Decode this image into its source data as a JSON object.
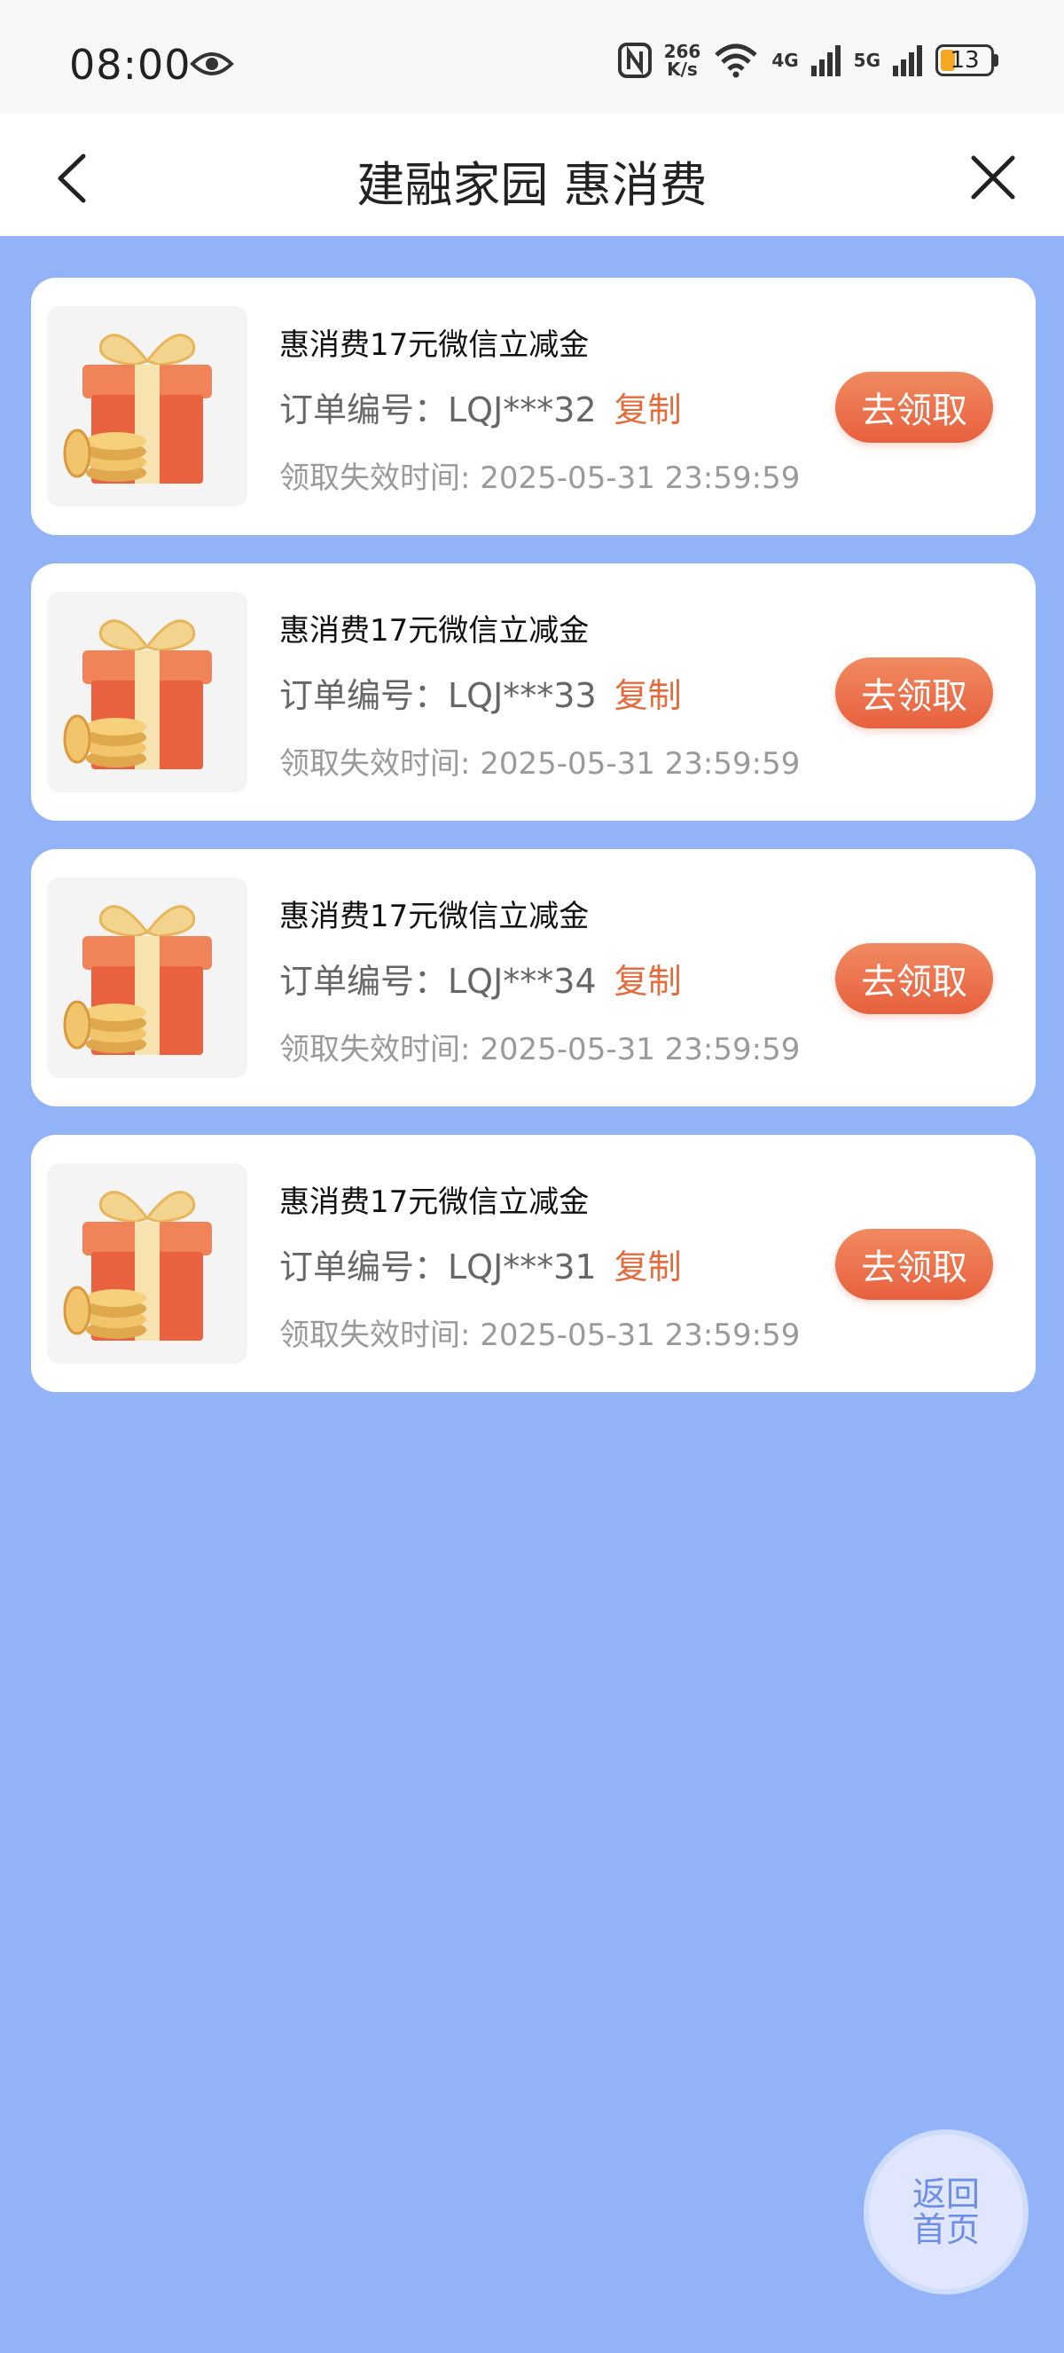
{
  "status_bar": {
    "time": "08:00",
    "speed_value": "266",
    "speed_unit": "K/s",
    "net_4g": "4G",
    "net_5g": "5G",
    "battery": "13",
    "battery_color": "#f5a623"
  },
  "nav": {
    "title": "建融家园 惠消费",
    "back_icon": "chevron-left-icon",
    "close_icon": "close-icon"
  },
  "coupons": [
    {
      "title": "惠消费17元微信立减金",
      "order_label": "订单编号：",
      "order_no": "LQJ***32",
      "copy_label": "复制",
      "expire_label": "领取失效时间: ",
      "expire_time": "2025-05-31 23:59:59",
      "claim_label": "去领取"
    },
    {
      "title": "惠消费17元微信立减金",
      "order_label": "订单编号：",
      "order_no": "LQJ***33",
      "copy_label": "复制",
      "expire_label": "领取失效时间: ",
      "expire_time": "2025-05-31 23:59:59",
      "claim_label": "去领取"
    },
    {
      "title": "惠消费17元微信立减金",
      "order_label": "订单编号：",
      "order_no": "LQJ***34",
      "copy_label": "复制",
      "expire_label": "领取失效时间: ",
      "expire_time": "2025-05-31 23:59:59",
      "claim_label": "去领取"
    },
    {
      "title": "惠消费17元微信立减金",
      "order_label": "订单编号：",
      "order_no": "LQJ***31",
      "copy_label": "复制",
      "expire_label": "领取失效时间: ",
      "expire_time": "2025-05-31 23:59:59",
      "claim_label": "去领取"
    }
  ],
  "home_button": {
    "line1": "返回",
    "line2": "首页"
  },
  "colors": {
    "background": "#93b3f8",
    "accent": "#e56a3c"
  }
}
